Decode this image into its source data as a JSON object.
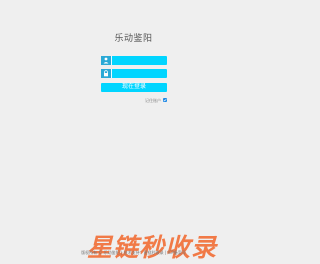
{
  "app": {
    "title": "乐动鉴阳"
  },
  "form": {
    "username_icon": "user-icon",
    "password_icon": "lock-icon",
    "username_value": "",
    "password_value": "",
    "login_label": "现在登录",
    "remember_label": "记住账户",
    "remember_checked": true
  },
  "footer": {
    "text": "版权所有 © 乐动鉴阳 | 技术支持：星链秒收录 | ICP备案号"
  },
  "watermark": {
    "text": "星链秒收录"
  },
  "colors": {
    "accent": "#00d5ff",
    "icon_bg": "#2aa9d6",
    "watermark": "#f25a18",
    "background": "#efefef"
  }
}
